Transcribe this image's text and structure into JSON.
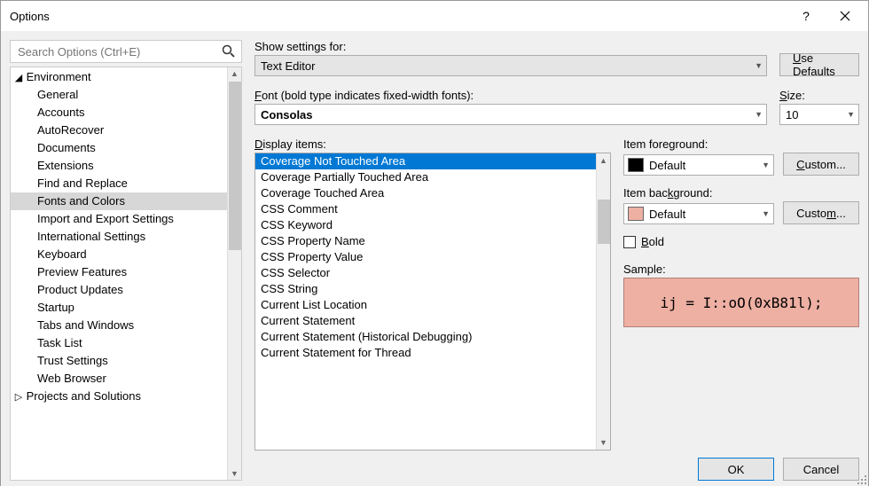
{
  "window": {
    "title": "Options"
  },
  "search": {
    "placeholder": "Search Options (Ctrl+E)"
  },
  "tree": {
    "expanded": "Environment",
    "children": [
      "General",
      "Accounts",
      "AutoRecover",
      "Documents",
      "Extensions",
      "Find and Replace",
      "Fonts and Colors",
      "Import and Export Settings",
      "International Settings",
      "Keyboard",
      "Preview Features",
      "Product Updates",
      "Startup",
      "Tabs and Windows",
      "Task List",
      "Trust Settings",
      "Web Browser"
    ],
    "selected": "Fonts and Colors",
    "collapsed": [
      "Projects and Solutions"
    ]
  },
  "settings": {
    "show_for_label": "Show settings for:",
    "show_for_value": "Text Editor",
    "use_defaults": "Use Defaults",
    "font_label": "Font (bold type indicates fixed-width fonts):",
    "font_value": "Consolas",
    "size_label": "Size:",
    "size_value": "10",
    "display_items_label": "Display items:",
    "display_items": [
      "Coverage Not Touched Area",
      "Coverage Partially Touched Area",
      "Coverage Touched Area",
      "CSS Comment",
      "CSS Keyword",
      "CSS Property Name",
      "CSS Property Value",
      "CSS Selector",
      "CSS String",
      "Current List Location",
      "Current Statement",
      "Current Statement (Historical Debugging)",
      "Current Statement for Thread"
    ],
    "display_selected": "Coverage Not Touched Area",
    "fg_label": "Item foreground:",
    "fg_value": "Default",
    "fg_swatch": "#000000",
    "bg_label": "Item background:",
    "bg_value": "Default",
    "bg_swatch": "#eeb0a3",
    "custom": "Custom...",
    "bold": "Bold",
    "bold_checked": false,
    "sample_label": "Sample:",
    "sample_text": "ij = I::oO(0xB81l);"
  },
  "buttons": {
    "ok": "OK",
    "cancel": "Cancel"
  }
}
